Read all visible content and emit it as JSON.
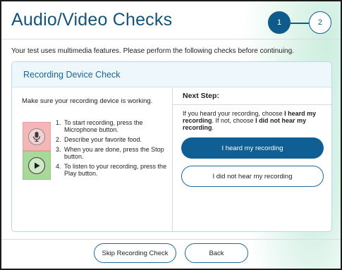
{
  "header": {
    "title": "Audio/Video Checks",
    "steps": [
      {
        "label": "1",
        "state": "active"
      },
      {
        "label": "2",
        "state": "upcoming"
      }
    ]
  },
  "intro_text": "Your test uses multimedia features. Please perform the following checks before continuing.",
  "card": {
    "title": "Recording Device Check",
    "left": {
      "instruction": "Make sure your recording device is working.",
      "controls": [
        {
          "name": "microphone",
          "icon": "microphone-icon",
          "color": "#f4b6b6"
        },
        {
          "name": "play",
          "icon": "play-icon",
          "color": "#a9d99a"
        }
      ],
      "steps": [
        {
          "num": "1.",
          "text": "To start recording, press the Microphone button."
        },
        {
          "num": "2.",
          "text": "Describe your favorite food."
        },
        {
          "num": "3.",
          "text": "When you are done, press the Stop button."
        },
        {
          "num": "4.",
          "text": "To listen to your recording, press the Play button."
        }
      ]
    },
    "right": {
      "heading": "Next Step:",
      "guidance_1": "If you heard your recording, choose ",
      "guidance_bold_1": "I heard my recording",
      "guidance_2": ". If not, choose ",
      "guidance_bold_2": "I did not hear my recording",
      "guidance_3": ".",
      "primary_button": "I heard my recording",
      "secondary_button": "I did not hear my recording"
    }
  },
  "footer": {
    "skip_button": "Skip Recording Check",
    "back_button": "Back"
  },
  "colors": {
    "brand": "#0f5f95",
    "title": "#13547a",
    "mic_bg": "#f4b6b6",
    "play_bg": "#a9d99a"
  }
}
